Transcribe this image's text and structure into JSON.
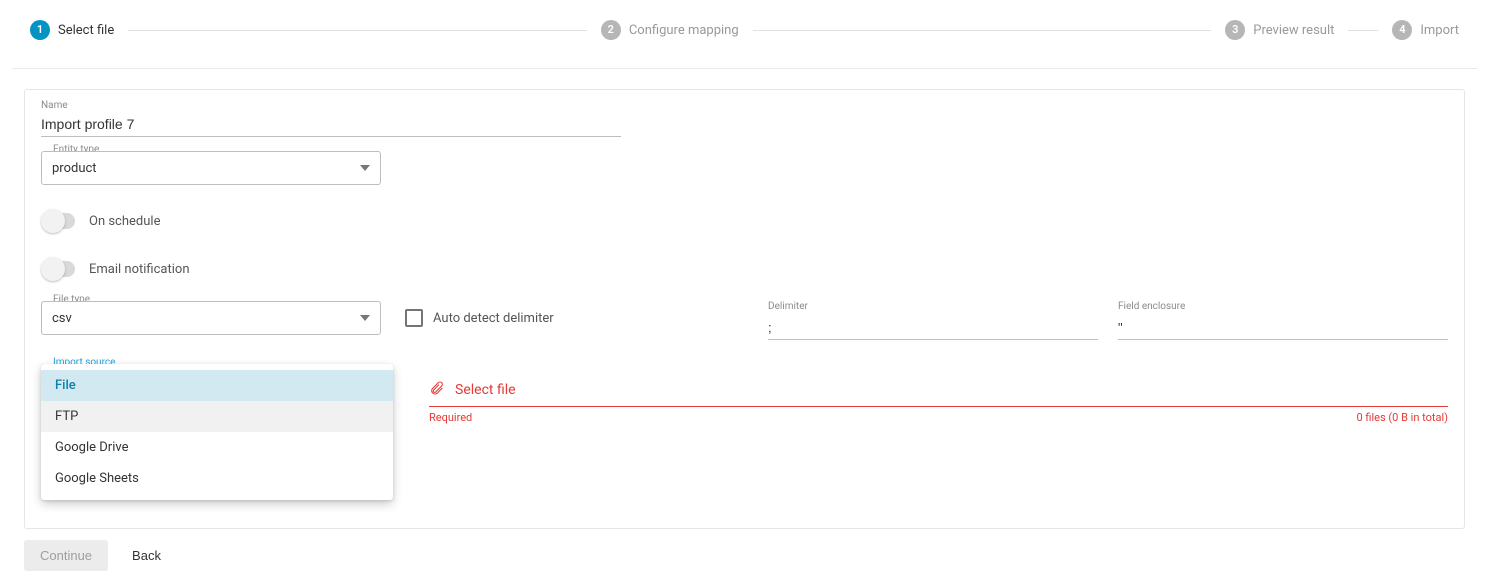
{
  "stepper": {
    "steps": [
      {
        "num": "1",
        "label": "Select file"
      },
      {
        "num": "2",
        "label": "Configure mapping"
      },
      {
        "num": "3",
        "label": "Preview result"
      },
      {
        "num": "4",
        "label": "Import"
      }
    ]
  },
  "name_field": {
    "label": "Name",
    "value": "Import profile 7"
  },
  "entity_type": {
    "label": "Entity type",
    "value": "product"
  },
  "on_schedule_label": "On schedule",
  "email_notification_label": "Email notification",
  "file_type": {
    "label": "File type",
    "value": "csv"
  },
  "auto_detect_label": "Auto detect delimiter",
  "delimiter": {
    "label": "Delimiter",
    "value": ";"
  },
  "enclosure": {
    "label": "Field enclosure",
    "value": "\""
  },
  "import_source": {
    "label": "Import source",
    "options": [
      "File",
      "FTP",
      "Google Drive",
      "Google Sheets"
    ],
    "selected_index": 0
  },
  "file_select": {
    "label": "Select file",
    "required_text": "Required",
    "summary": "0 files (0 B in total)"
  },
  "footer": {
    "continue": "Continue",
    "back": "Back"
  }
}
